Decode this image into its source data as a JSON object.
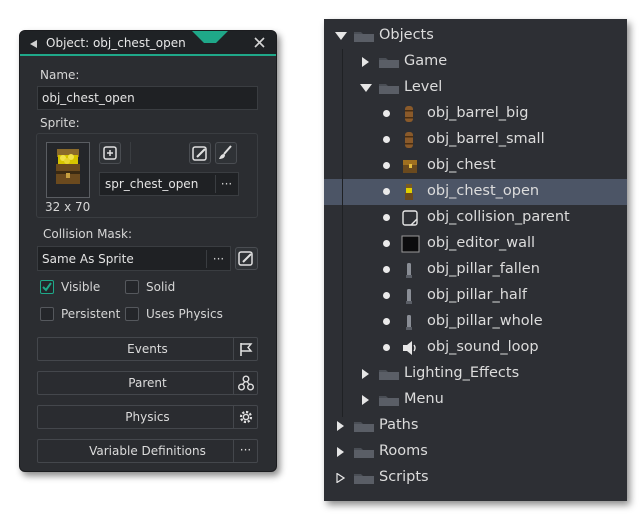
{
  "object_panel": {
    "title": "Object: obj_chest_open",
    "name_label": "Name:",
    "name_value": "obj_chest_open",
    "sprite_label": "Sprite:",
    "sprite_name": "spr_chest_open",
    "sprite_size": "32 x 70",
    "sprite_dots": "···",
    "mask_label": "Collision Mask:",
    "mask_value": "Same As Sprite",
    "mask_dots": "···",
    "checkboxes": [
      {
        "label": "Visible",
        "checked": true
      },
      {
        "label": "Solid",
        "checked": false
      },
      {
        "label": "Persistent",
        "checked": false
      },
      {
        "label": "Uses Physics",
        "checked": false
      }
    ],
    "buttons": [
      {
        "label": "Events",
        "icon": "flag-icon"
      },
      {
        "label": "Parent",
        "icon": "hierarchy-icon"
      },
      {
        "label": "Physics",
        "icon": "gear-icon"
      },
      {
        "label": "Variable Definitions",
        "icon": "more-dots-icon",
        "icon_text": "···"
      }
    ],
    "accent_color": "#1fa889"
  },
  "resource_tree": {
    "items": [
      {
        "label": "Objects",
        "kind": "folder",
        "expanded": true
      },
      {
        "label": "Game",
        "kind": "folder",
        "expanded": false
      },
      {
        "label": "Level",
        "kind": "folder",
        "expanded": true
      },
      {
        "label": "obj_barrel_big",
        "kind": "object",
        "icon": "barrel-icon"
      },
      {
        "label": "obj_barrel_small",
        "kind": "object",
        "icon": "barrel-icon"
      },
      {
        "label": "obj_chest",
        "kind": "object",
        "icon": "chest-icon"
      },
      {
        "label": "obj_chest_open",
        "kind": "object",
        "icon": "open-chest-icon",
        "selected": true
      },
      {
        "label": "obj_collision_parent",
        "kind": "object",
        "icon": "blank-sprite-icon"
      },
      {
        "label": "obj_editor_wall",
        "kind": "object",
        "icon": "wall-sprite-icon"
      },
      {
        "label": "obj_pillar_fallen",
        "kind": "object",
        "icon": "pillar-icon"
      },
      {
        "label": "obj_pillar_half",
        "kind": "object",
        "icon": "pillar-icon"
      },
      {
        "label": "obj_pillar_whole",
        "kind": "object",
        "icon": "pillar-icon"
      },
      {
        "label": "obj_sound_loop",
        "kind": "object",
        "icon": "speaker-icon"
      },
      {
        "label": "Lighting_Effects",
        "kind": "folder",
        "expanded": false
      },
      {
        "label": "Menu",
        "kind": "folder",
        "expanded": false
      },
      {
        "label": "Paths",
        "kind": "folder",
        "expanded": false
      },
      {
        "label": "Rooms",
        "kind": "folder",
        "expanded": false
      },
      {
        "label": "Scripts",
        "kind": "folder",
        "expanded": false
      }
    ],
    "selected_color": "#4c5566"
  }
}
